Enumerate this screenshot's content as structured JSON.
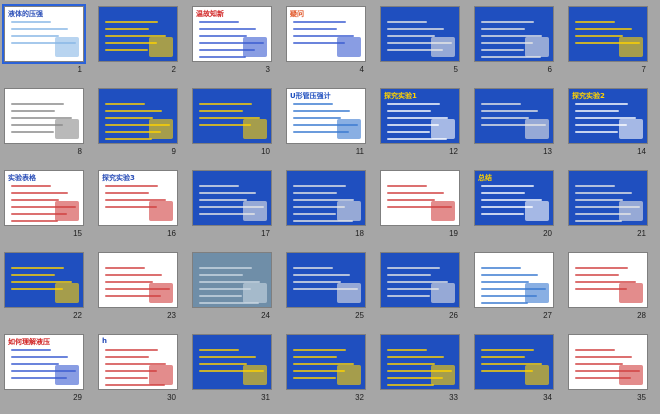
{
  "slides": [
    {
      "n": "1",
      "title": "液体的压强",
      "bg": "#ffffff",
      "fg": "#2b4fb8",
      "accent": "#88b7e6"
    },
    {
      "n": "2",
      "title": "",
      "bg": "#1f4fbf",
      "fg": "#ffffff",
      "accent": "#ffd200"
    },
    {
      "n": "3",
      "title": "温故知新",
      "bg": "#ffffff",
      "fg": "#d02020",
      "accent": "#3a5bd0"
    },
    {
      "n": "4",
      "title": "疑问",
      "bg": "#ffffff",
      "fg": "#e05020",
      "accent": "#3a5bd0"
    },
    {
      "n": "5",
      "title": "",
      "bg": "#1f4fbf",
      "fg": "#ffffff",
      "accent": "#e6e6e6"
    },
    {
      "n": "6",
      "title": "",
      "bg": "#1f4fbf",
      "fg": "#ffffff",
      "accent": "#e6e6e6"
    },
    {
      "n": "7",
      "title": "",
      "bg": "#1f4fbf",
      "fg": "#ffffff",
      "accent": "#ffd200"
    },
    {
      "n": "8",
      "title": "",
      "bg": "#ffffff",
      "fg": "#1f4fbf",
      "accent": "#8a8a8a"
    },
    {
      "n": "9",
      "title": "",
      "bg": "#1f4fbf",
      "fg": "#ffffff",
      "accent": "#ffd200"
    },
    {
      "n": "10",
      "title": "",
      "bg": "#1f4fbf",
      "fg": "#ffffff",
      "accent": "#ffd200"
    },
    {
      "n": "11",
      "title": "U形管压强计",
      "bg": "#ffffff",
      "fg": "#1f4fbf",
      "accent": "#3a7ad0"
    },
    {
      "n": "12",
      "title": "探究实验1",
      "bg": "#1f4fbf",
      "fg": "#ffd200",
      "accent": "#ffffff"
    },
    {
      "n": "13",
      "title": "",
      "bg": "#1f4fbf",
      "fg": "#ffffff",
      "accent": "#e6e6e6"
    },
    {
      "n": "14",
      "title": "探究实验2",
      "bg": "#1f4fbf",
      "fg": "#ffd200",
      "accent": "#ffffff"
    },
    {
      "n": "15",
      "title": "实验表格",
      "bg": "#ffffff",
      "fg": "#2b4fb8",
      "accent": "#d04040"
    },
    {
      "n": "16",
      "title": "探究实验3",
      "bg": "#ffffff",
      "fg": "#2b4fb8",
      "accent": "#d04040"
    },
    {
      "n": "17",
      "title": "",
      "bg": "#1f4fbf",
      "fg": "#ffffff",
      "accent": "#e6e6e6"
    },
    {
      "n": "18",
      "title": "",
      "bg": "#1f4fbf",
      "fg": "#ffffff",
      "accent": "#e6e6e6"
    },
    {
      "n": "19",
      "title": "",
      "bg": "#ffffff",
      "fg": "#2b4fb8",
      "accent": "#d04040"
    },
    {
      "n": "20",
      "title": "总结",
      "bg": "#1f4fbf",
      "fg": "#ffd200",
      "accent": "#ffffff"
    },
    {
      "n": "21",
      "title": "",
      "bg": "#1f4fbf",
      "fg": "#ffffff",
      "accent": "#e6e6e6"
    },
    {
      "n": "22",
      "title": "",
      "bg": "#1f4fbf",
      "fg": "#ffffff",
      "accent": "#ffd200"
    },
    {
      "n": "23",
      "title": "",
      "bg": "#ffffff",
      "fg": "#2b4fb8",
      "accent": "#d04040"
    },
    {
      "n": "24",
      "title": "",
      "bg": "#6f8ea8",
      "fg": "#ffffff",
      "accent": "#c9d7e3"
    },
    {
      "n": "25",
      "title": "",
      "bg": "#1f4fbf",
      "fg": "#ffffff",
      "accent": "#e6e6e6"
    },
    {
      "n": "26",
      "title": "",
      "bg": "#1f4fbf",
      "fg": "#ffffff",
      "accent": "#e6e6e6"
    },
    {
      "n": "27",
      "title": "",
      "bg": "#ffffff",
      "fg": "#2b4fb8",
      "accent": "#3a7ad0"
    },
    {
      "n": "28",
      "title": "",
      "bg": "#ffffff",
      "fg": "#2b4fb8",
      "accent": "#d04040"
    },
    {
      "n": "29",
      "title": "如何理解液压",
      "bg": "#ffffff",
      "fg": "#d02020",
      "accent": "#3a5bd0"
    },
    {
      "n": "30",
      "title": "h",
      "bg": "#ffffff",
      "fg": "#2b4fb8",
      "accent": "#d04040"
    },
    {
      "n": "31",
      "title": "",
      "bg": "#1f4fbf",
      "fg": "#ffffff",
      "accent": "#ffd200"
    },
    {
      "n": "32",
      "title": "",
      "bg": "#1f4fbf",
      "fg": "#ffffff",
      "accent": "#ffd200"
    },
    {
      "n": "33",
      "title": "",
      "bg": "#1f4fbf",
      "fg": "#ffffff",
      "accent": "#ffd200"
    },
    {
      "n": "34",
      "title": "",
      "bg": "#1f4fbf",
      "fg": "#ffffff",
      "accent": "#ffd200"
    },
    {
      "n": "35",
      "title": "",
      "bg": "#ffffff",
      "fg": "#2b4fb8",
      "accent": "#d04040"
    }
  ],
  "selected": "1"
}
